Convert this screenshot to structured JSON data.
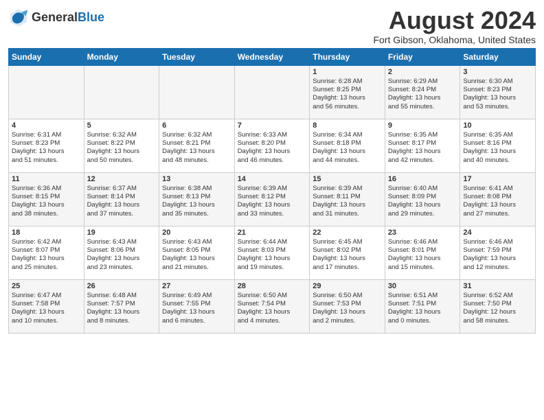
{
  "header": {
    "logo_general": "General",
    "logo_blue": "Blue",
    "title": "August 2024",
    "subtitle": "Fort Gibson, Oklahoma, United States"
  },
  "days_of_week": [
    "Sunday",
    "Monday",
    "Tuesday",
    "Wednesday",
    "Thursday",
    "Friday",
    "Saturday"
  ],
  "weeks": [
    [
      {
        "day": "",
        "info": ""
      },
      {
        "day": "",
        "info": ""
      },
      {
        "day": "",
        "info": ""
      },
      {
        "day": "",
        "info": ""
      },
      {
        "day": "1",
        "info": "Sunrise: 6:28 AM\nSunset: 8:25 PM\nDaylight: 13 hours\nand 56 minutes."
      },
      {
        "day": "2",
        "info": "Sunrise: 6:29 AM\nSunset: 8:24 PM\nDaylight: 13 hours\nand 55 minutes."
      },
      {
        "day": "3",
        "info": "Sunrise: 6:30 AM\nSunset: 8:23 PM\nDaylight: 13 hours\nand 53 minutes."
      }
    ],
    [
      {
        "day": "4",
        "info": "Sunrise: 6:31 AM\nSunset: 8:23 PM\nDaylight: 13 hours\nand 51 minutes."
      },
      {
        "day": "5",
        "info": "Sunrise: 6:32 AM\nSunset: 8:22 PM\nDaylight: 13 hours\nand 50 minutes."
      },
      {
        "day": "6",
        "info": "Sunrise: 6:32 AM\nSunset: 8:21 PM\nDaylight: 13 hours\nand 48 minutes."
      },
      {
        "day": "7",
        "info": "Sunrise: 6:33 AM\nSunset: 8:20 PM\nDaylight: 13 hours\nand 46 minutes."
      },
      {
        "day": "8",
        "info": "Sunrise: 6:34 AM\nSunset: 8:18 PM\nDaylight: 13 hours\nand 44 minutes."
      },
      {
        "day": "9",
        "info": "Sunrise: 6:35 AM\nSunset: 8:17 PM\nDaylight: 13 hours\nand 42 minutes."
      },
      {
        "day": "10",
        "info": "Sunrise: 6:35 AM\nSunset: 8:16 PM\nDaylight: 13 hours\nand 40 minutes."
      }
    ],
    [
      {
        "day": "11",
        "info": "Sunrise: 6:36 AM\nSunset: 8:15 PM\nDaylight: 13 hours\nand 38 minutes."
      },
      {
        "day": "12",
        "info": "Sunrise: 6:37 AM\nSunset: 8:14 PM\nDaylight: 13 hours\nand 37 minutes."
      },
      {
        "day": "13",
        "info": "Sunrise: 6:38 AM\nSunset: 8:13 PM\nDaylight: 13 hours\nand 35 minutes."
      },
      {
        "day": "14",
        "info": "Sunrise: 6:39 AM\nSunset: 8:12 PM\nDaylight: 13 hours\nand 33 minutes."
      },
      {
        "day": "15",
        "info": "Sunrise: 6:39 AM\nSunset: 8:11 PM\nDaylight: 13 hours\nand 31 minutes."
      },
      {
        "day": "16",
        "info": "Sunrise: 6:40 AM\nSunset: 8:09 PM\nDaylight: 13 hours\nand 29 minutes."
      },
      {
        "day": "17",
        "info": "Sunrise: 6:41 AM\nSunset: 8:08 PM\nDaylight: 13 hours\nand 27 minutes."
      }
    ],
    [
      {
        "day": "18",
        "info": "Sunrise: 6:42 AM\nSunset: 8:07 PM\nDaylight: 13 hours\nand 25 minutes."
      },
      {
        "day": "19",
        "info": "Sunrise: 6:43 AM\nSunset: 8:06 PM\nDaylight: 13 hours\nand 23 minutes."
      },
      {
        "day": "20",
        "info": "Sunrise: 6:43 AM\nSunset: 8:05 PM\nDaylight: 13 hours\nand 21 minutes."
      },
      {
        "day": "21",
        "info": "Sunrise: 6:44 AM\nSunset: 8:03 PM\nDaylight: 13 hours\nand 19 minutes."
      },
      {
        "day": "22",
        "info": "Sunrise: 6:45 AM\nSunset: 8:02 PM\nDaylight: 13 hours\nand 17 minutes."
      },
      {
        "day": "23",
        "info": "Sunrise: 6:46 AM\nSunset: 8:01 PM\nDaylight: 13 hours\nand 15 minutes."
      },
      {
        "day": "24",
        "info": "Sunrise: 6:46 AM\nSunset: 7:59 PM\nDaylight: 13 hours\nand 12 minutes."
      }
    ],
    [
      {
        "day": "25",
        "info": "Sunrise: 6:47 AM\nSunset: 7:58 PM\nDaylight: 13 hours\nand 10 minutes."
      },
      {
        "day": "26",
        "info": "Sunrise: 6:48 AM\nSunset: 7:57 PM\nDaylight: 13 hours\nand 8 minutes."
      },
      {
        "day": "27",
        "info": "Sunrise: 6:49 AM\nSunset: 7:55 PM\nDaylight: 13 hours\nand 6 minutes."
      },
      {
        "day": "28",
        "info": "Sunrise: 6:50 AM\nSunset: 7:54 PM\nDaylight: 13 hours\nand 4 minutes."
      },
      {
        "day": "29",
        "info": "Sunrise: 6:50 AM\nSunset: 7:53 PM\nDaylight: 13 hours\nand 2 minutes."
      },
      {
        "day": "30",
        "info": "Sunrise: 6:51 AM\nSunset: 7:51 PM\nDaylight: 13 hours\nand 0 minutes."
      },
      {
        "day": "31",
        "info": "Sunrise: 6:52 AM\nSunset: 7:50 PM\nDaylight: 12 hours\nand 58 minutes."
      }
    ]
  ]
}
